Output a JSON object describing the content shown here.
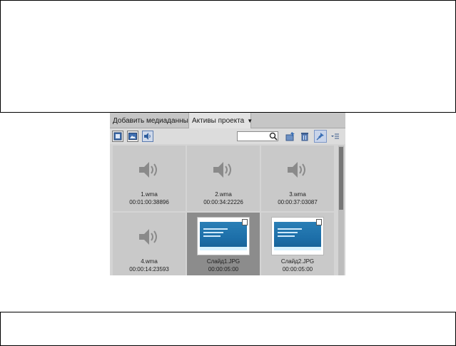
{
  "tabs": [
    {
      "label": "Добавить медиаданные"
    },
    {
      "label": "Активы проекта"
    }
  ],
  "toolbar": {
    "search": {
      "value": "",
      "placeholder": ""
    }
  },
  "assets": [
    {
      "name": "1.wma",
      "duration": "00:01:00:38896",
      "type": "audio",
      "selected": false
    },
    {
      "name": "2.wma",
      "duration": "00:00:34:22226",
      "type": "audio",
      "selected": false
    },
    {
      "name": "3.wma",
      "duration": "00:00:37:03087",
      "type": "audio",
      "selected": false
    },
    {
      "name": "4.wma",
      "duration": "00:00:14:23593",
      "type": "audio",
      "selected": false
    },
    {
      "name": "Слайд1.JPG",
      "duration": "00:00:05:00",
      "type": "image",
      "selected": true
    },
    {
      "name": "Слайд2.JPG",
      "duration": "00:00:05:00",
      "type": "image",
      "selected": false
    }
  ],
  "colors": {
    "panel_bg": "#d4d4d4",
    "cell_bg": "#c9c9c9",
    "cell_selected_bg": "#8c8c8c",
    "accent": "#5a7bb0"
  }
}
